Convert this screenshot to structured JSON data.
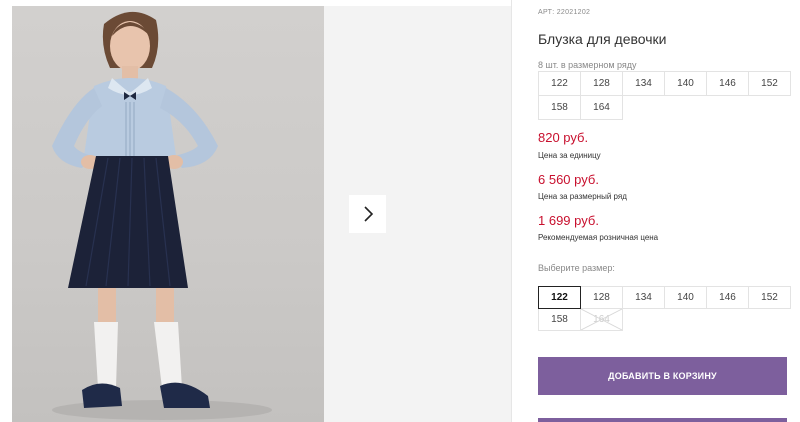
{
  "product": {
    "sku": "АРТ: 22021202",
    "title": "Блузка для девочки",
    "image_alt": "girl-in-blue-blouse-and-navy-skirt"
  },
  "size_row": {
    "note": "8 шт. в размерном ряду",
    "sizes": [
      "122",
      "128",
      "134",
      "140",
      "146",
      "152",
      "158",
      "164"
    ]
  },
  "prices": [
    {
      "amount": "820 руб.",
      "caption": "Цена за единицу"
    },
    {
      "amount": "6 560 руб.",
      "caption": "Цена за размерный ряд"
    },
    {
      "amount": "1 699 руб.",
      "caption": "Рекомендуемая розничная цена"
    }
  ],
  "size_picker": {
    "label": "Выберите размер:",
    "sizes": [
      "122",
      "128",
      "134",
      "140",
      "146",
      "152",
      "158",
      "164"
    ],
    "selected": "122",
    "unavailable": [
      "164"
    ]
  },
  "actions": {
    "add_to_cart": "ДОБАВИТЬ В КОРЗИНУ"
  },
  "icons": {
    "next": "chevron-right-icon"
  },
  "colors": {
    "accent": "#7d5f9d",
    "price": "#c8102e"
  }
}
